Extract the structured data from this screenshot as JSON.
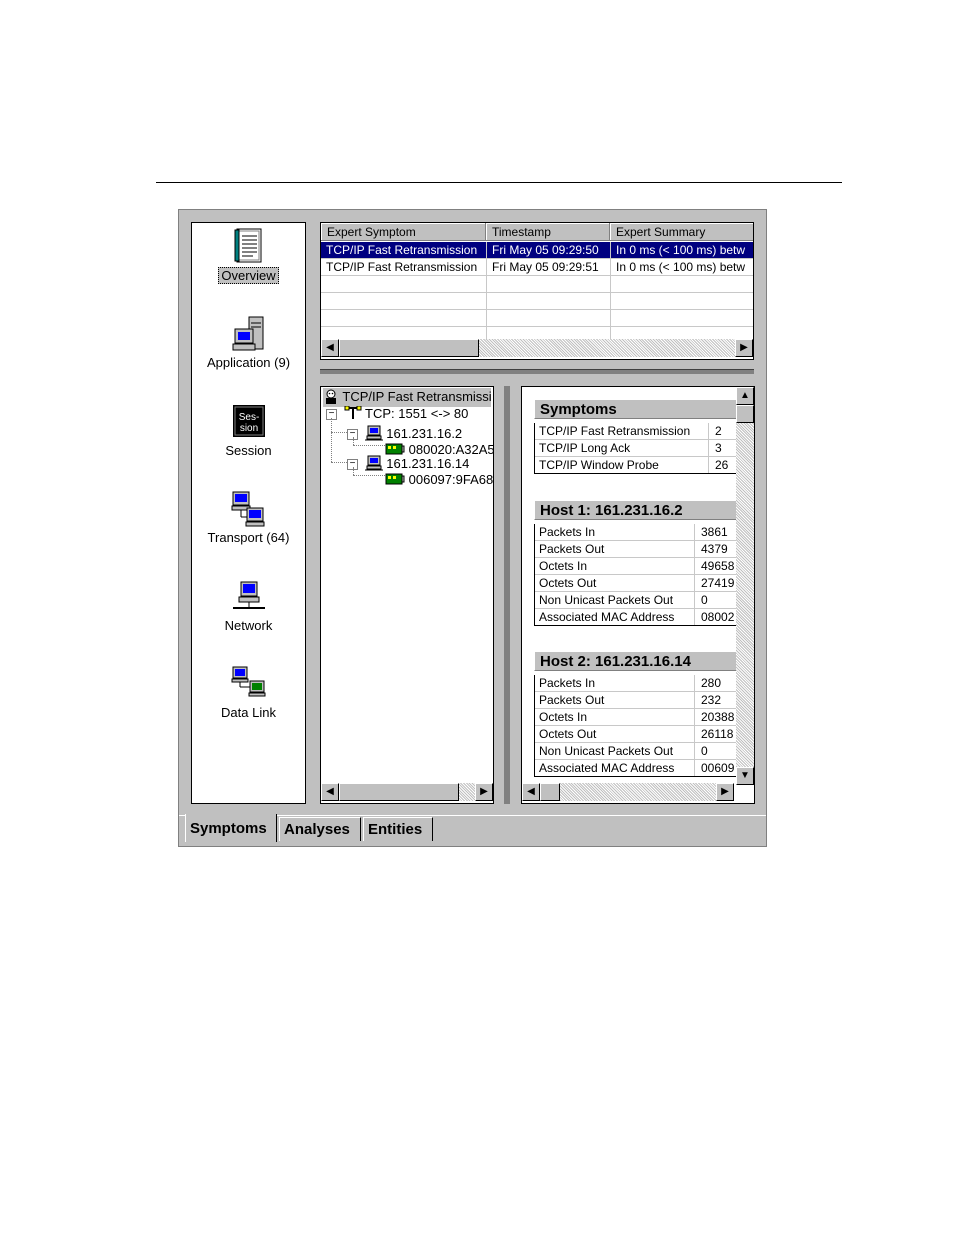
{
  "sidebar": {
    "items": [
      {
        "label": "Overview",
        "icon": "notebook-icon"
      },
      {
        "label": "Application (9)",
        "icon": "computer-server-icon"
      },
      {
        "label": "Session",
        "icon": "session-icon"
      },
      {
        "label": "Transport (64)",
        "icon": "transport-computers-icon"
      },
      {
        "label": "Network",
        "icon": "network-computer-icon"
      },
      {
        "label": "Data Link",
        "icon": "data-link-icon"
      }
    ],
    "session_icon_text": [
      "Ses-",
      "sion"
    ]
  },
  "symptom_table": {
    "columns": [
      "Expert Symptom",
      "Timestamp",
      "Expert Summary"
    ],
    "rows": [
      [
        "TCP/IP Fast Retransmission",
        "Fri May 05 09:29:50",
        "In 0 ms (< 100 ms) betw"
      ],
      [
        "TCP/IP Fast Retransmission",
        "Fri May 05 09:29:51",
        "In 0 ms (< 100 ms) betw"
      ]
    ]
  },
  "tree": {
    "root": "TCP/IP Fast Retransmissio",
    "connection": "TCP: 1551 <-> 80",
    "hosts": [
      {
        "ip": "161.231.16.2",
        "mac": "080020:A32A5"
      },
      {
        "ip": "161.231.16.14",
        "mac": "006097:9FA68"
      }
    ]
  },
  "detail": {
    "symptoms": {
      "title": "Symptoms",
      "rows": [
        [
          "TCP/IP Fast Retransmission",
          "2"
        ],
        [
          "TCP/IP Long Ack",
          "3"
        ],
        [
          "TCP/IP Window Probe",
          "26"
        ]
      ]
    },
    "host1": {
      "title": "Host 1: 161.231.16.2",
      "rows": [
        [
          "Packets In",
          "3861"
        ],
        [
          "Packets Out",
          "4379"
        ],
        [
          "Octets In",
          "49658"
        ],
        [
          "Octets Out",
          "27419"
        ],
        [
          "Non Unicast Packets Out",
          "0"
        ],
        [
          "Associated MAC Address",
          "08002"
        ]
      ]
    },
    "host2": {
      "title": "Host 2: 161.231.16.14",
      "rows": [
        [
          "Packets In",
          "280"
        ],
        [
          "Packets Out",
          "232"
        ],
        [
          "Octets In",
          "20388"
        ],
        [
          "Octets Out",
          "26118"
        ],
        [
          "Non Unicast Packets Out",
          "0"
        ],
        [
          "Associated MAC Address",
          "00609"
        ]
      ]
    }
  },
  "tabs": [
    {
      "label": "Symptoms",
      "active": true
    },
    {
      "label": "Analyses",
      "active": false
    },
    {
      "label": "Entities",
      "active": false
    }
  ],
  "scroll": {
    "left_arrow": "◀",
    "right_arrow": "▶",
    "up_arrow": "▲",
    "down_arrow": "▼",
    "expand_minus": "−"
  },
  "colors": {
    "selection": "#000080",
    "face": "#c0c0c0"
  }
}
